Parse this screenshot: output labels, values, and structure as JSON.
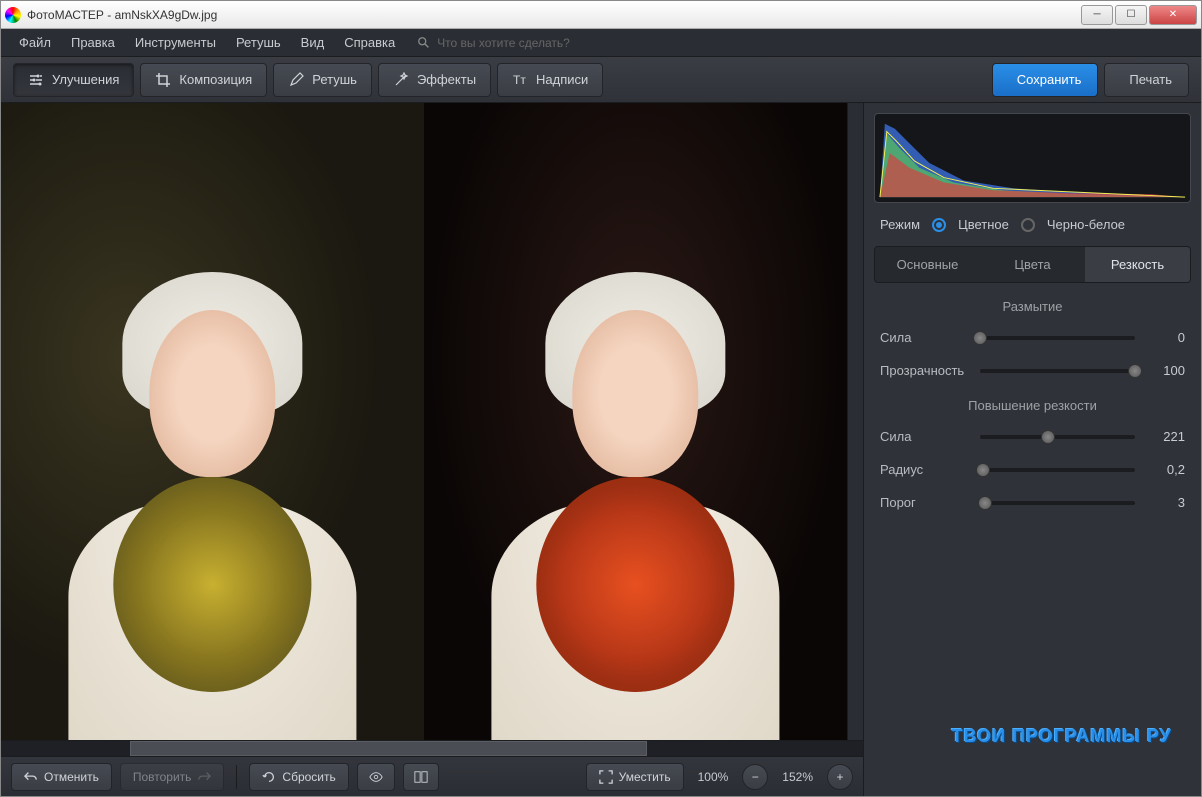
{
  "window": {
    "title": "ФотоМАСТЕР - amNskXA9gDw.jpg"
  },
  "menu": {
    "file": "Файл",
    "edit": "Правка",
    "tools": "Инструменты",
    "retouch": "Ретушь",
    "view": "Вид",
    "help": "Справка",
    "search_placeholder": "Что вы хотите сделать?"
  },
  "toolbar": {
    "enhance": "Улучшения",
    "composition": "Композиция",
    "retouch": "Ретушь",
    "effects": "Эффекты",
    "text": "Надписи",
    "save": "Сохранить",
    "print": "Печать"
  },
  "bottombar": {
    "undo": "Отменить",
    "redo": "Повторить",
    "reset": "Сбросить",
    "fit": "Уместить",
    "zoom1": "100%",
    "zoom2": "152%"
  },
  "panel": {
    "mode_label": "Режим",
    "mode_color": "Цветное",
    "mode_bw": "Черно-белое",
    "tab_basic": "Основные",
    "tab_colors": "Цвета",
    "tab_sharp": "Резкость",
    "section_blur": "Размытие",
    "section_sharpen": "Повышение резкости",
    "sliders": {
      "strength1": {
        "label": "Сила",
        "value": "0",
        "pos": 0
      },
      "opacity": {
        "label": "Прозрачность",
        "value": "100",
        "pos": 100
      },
      "strength2": {
        "label": "Сила",
        "value": "221",
        "pos": 44
      },
      "radius": {
        "label": "Радиус",
        "value": "0,2",
        "pos": 2
      },
      "threshold": {
        "label": "Порог",
        "value": "3",
        "pos": 3
      }
    }
  },
  "watermark": "ТВОИ ПРОГРАММЫ РУ"
}
